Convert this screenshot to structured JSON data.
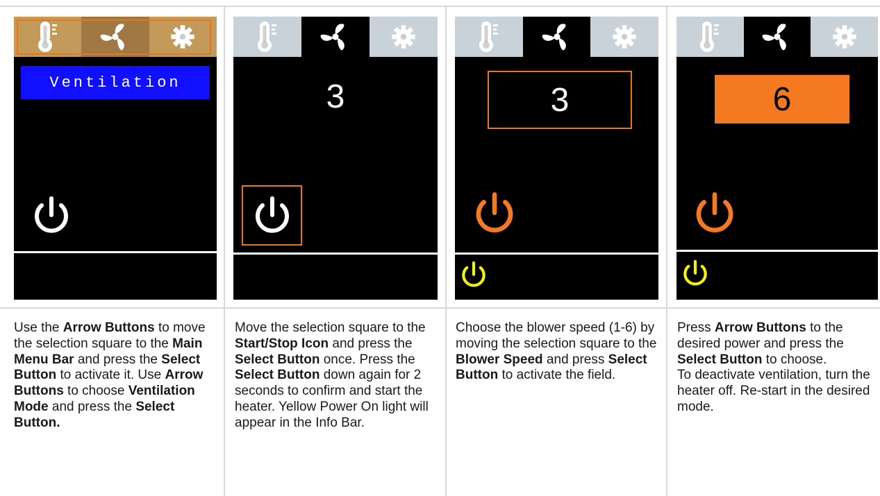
{
  "panels": [
    {
      "mode_label": "Ventilation",
      "caption": [
        {
          "t": "Use the "
        },
        {
          "b": "Arrow Buttons"
        },
        {
          "t": " to move the selection square to the "
        },
        {
          "b": "Main Menu Bar"
        },
        {
          "t": " and press the "
        },
        {
          "b": "Select Button"
        },
        {
          "t": " to activate it. Use "
        },
        {
          "b": "Arrow Buttons"
        },
        {
          "t": " to choose "
        },
        {
          "b": "Ventilation Mode"
        },
        {
          "t": " and press the "
        },
        {
          "b": "Select Button."
        }
      ]
    },
    {
      "speed_value": "3",
      "caption": [
        {
          "t": "Move the selection square to the "
        },
        {
          "b": "Start/Stop Icon"
        },
        {
          "t": " and press the "
        },
        {
          "b": "Select Button"
        },
        {
          "t": " once. Press the "
        },
        {
          "b": "Select Button"
        },
        {
          "t": " down again for 2 seconds to confirm and start the heater. Yellow Power On light will appear in the Info Bar."
        }
      ]
    },
    {
      "speed_value": "3",
      "caption": [
        {
          "t": "Choose the blower speed (1-6) by moving the selection square to the "
        },
        {
          "b": "Blower Speed"
        },
        {
          "t": " and press "
        },
        {
          "b": "Select Button"
        },
        {
          "t": " to activate the field."
        }
      ]
    },
    {
      "speed_value": "6",
      "caption": [
        {
          "t": "Press "
        },
        {
          "b": "Arrow Buttons"
        },
        {
          "t": " to the desired power and press the "
        },
        {
          "b": "Select Button"
        },
        {
          "t": " to choose.\nTo deactivate ventilation, turn the heater off. Re-start in the desired mode."
        }
      ]
    }
  ],
  "icons": [
    "thermometer-icon",
    "fan-icon",
    "gear-icon",
    "power-icon"
  ],
  "colors": {
    "menu_active_tan": "#c49a5a",
    "menu_tan_highlight": "#a07844",
    "menu_inactive_grey": "#c8d2d8",
    "ventilation_blue": "#1010ff",
    "orange": "#f47920",
    "yellow": "#f2f20a",
    "selection_outline": "#e8761a"
  }
}
